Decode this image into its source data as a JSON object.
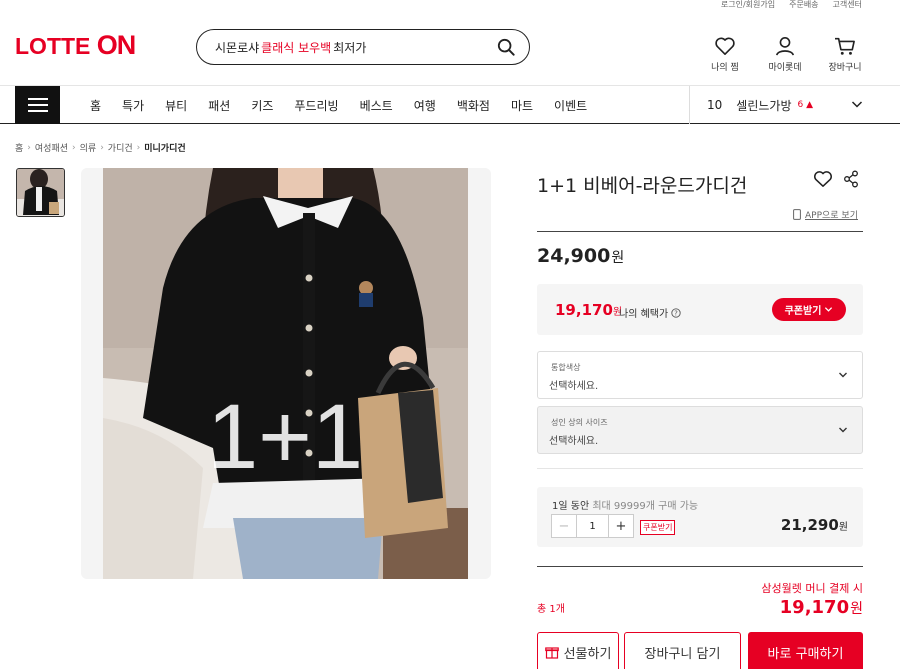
{
  "util_links": [
    "로그인/회원가입",
    "주문배송",
    "고객센터"
  ],
  "logo": {
    "text1": "LOTTE",
    "text2": "ON"
  },
  "search": {
    "kw1": "시몬로샤",
    "kw2": "클래식 보우백",
    "kw3": "최저가"
  },
  "header_icons": {
    "wish": "나의 찜",
    "mylotte": "마이롯데",
    "cart": "장바구니"
  },
  "nav": [
    "홈",
    "특가",
    "뷰티",
    "패션",
    "키즈",
    "푸드리빙",
    "베스트",
    "여행",
    "백화점",
    "마트",
    "이벤트"
  ],
  "rank": {
    "num": "10",
    "keyword": "셀린느가방",
    "delta": "6 ▲"
  },
  "breadcrumb": [
    "홈",
    "여성패션",
    "의류",
    "가디건",
    "미니가디건"
  ],
  "image_overlay": "1+1",
  "product": {
    "title": "1+1 비베어-라운드가디건",
    "app_view": "APP으로 보기",
    "price": "24,900",
    "won": "원"
  },
  "benefit": {
    "price": "19,170",
    "won": "원",
    "label": "나의 혜택가",
    "coupon_btn": "쿠폰받기"
  },
  "options": [
    {
      "label": "통합색상",
      "value": "선택하세요."
    },
    {
      "label": "성인 상의 사이즈",
      "value": "선택하세요."
    }
  ],
  "quantity": {
    "limit_a": "1일 동안",
    "limit_b": "최대 99999개",
    "limit_c": "구매 가능",
    "value": "1",
    "coupon": "쿠폰받기",
    "price": "21,290",
    "won": "원"
  },
  "total": {
    "label": "총 1개",
    "note": "삼성월렛 머니 결제 시",
    "price": "19,170",
    "won": "원"
  },
  "buttons": {
    "gift": "선물하기",
    "cart": "장바구니 담기",
    "buy": "바로 구매하기"
  },
  "colors": {
    "accent": "#e60023",
    "dark": "#111111"
  }
}
